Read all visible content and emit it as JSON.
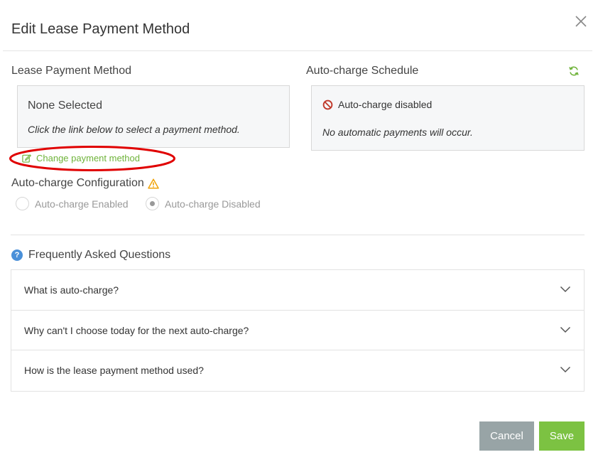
{
  "modal": {
    "title": "Edit Lease Payment Method",
    "close_icon": "close-icon"
  },
  "lease_payment_method": {
    "label": "Lease Payment Method",
    "selection": "None Selected",
    "hint": "Click the link below to select a payment method.",
    "change_link": "Change payment method"
  },
  "autocharge_schedule": {
    "label": "Auto-charge Schedule",
    "status": "Auto-charge disabled",
    "note": "No automatic payments will occur."
  },
  "autocharge_config": {
    "label": "Auto-charge Configuration",
    "options": [
      {
        "label": "Auto-charge Enabled",
        "selected": false
      },
      {
        "label": "Auto-charge Disabled",
        "selected": true
      }
    ]
  },
  "faq": {
    "title": "Frequently Asked Questions",
    "items": [
      {
        "question": "What is auto-charge?"
      },
      {
        "question": "Why can't I choose today for the next auto-charge?"
      },
      {
        "question": "How is the lease payment method used?"
      }
    ]
  },
  "buttons": {
    "cancel": "Cancel",
    "save": "Save"
  },
  "colors": {
    "accent_green": "#7cc242",
    "link_green": "#6fb33a",
    "cancel_gray": "#98a4a6",
    "danger_red": "#c0392b",
    "warning_orange": "#f0a30a",
    "info_blue": "#4a90d9",
    "annotation_red": "#e00000"
  }
}
